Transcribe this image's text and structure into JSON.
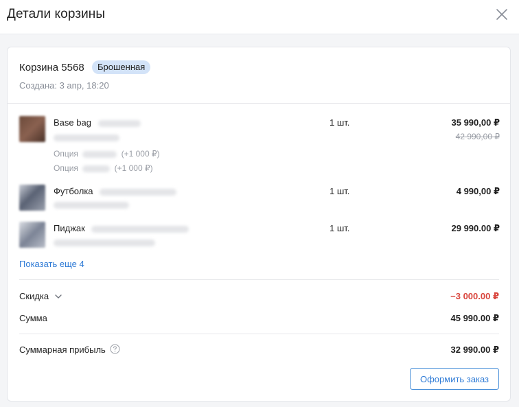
{
  "header": {
    "title": "Детали корзины"
  },
  "cart": {
    "title": "Корзина 5568",
    "status": "Брошенная",
    "created": "Создана: 3 апр, 18:20"
  },
  "items": [
    {
      "name": "Base bag",
      "qty": "1 шт.",
      "price": "35 990,00 ₽",
      "old_price": "42 990,00 ₽",
      "options": [
        {
          "label": "Опция",
          "extra": "(+1 000 ₽)"
        },
        {
          "label": "Опция",
          "extra": "(+1 000 ₽)"
        }
      ]
    },
    {
      "name": "Футболка",
      "qty": "1 шт.",
      "price": "4 990,00 ₽"
    },
    {
      "name": "Пиджак",
      "qty": "1 шт.",
      "price": "29 990.00 ₽"
    }
  ],
  "show_more": "Показать еще 4",
  "summary": {
    "discount_label": "Скидка",
    "discount_value": "−3 000.00 ₽",
    "sum_label": "Сумма",
    "sum_value": "45 990.00 ₽",
    "profit_label": "Суммарная прибыль",
    "profit_value": "32 990.00 ₽"
  },
  "actions": {
    "order_button": "Оформить заказ"
  },
  "colors": {
    "accent": "#2f7bd6",
    "badge": "#d3e3f8",
    "discount": "#d9453d"
  }
}
